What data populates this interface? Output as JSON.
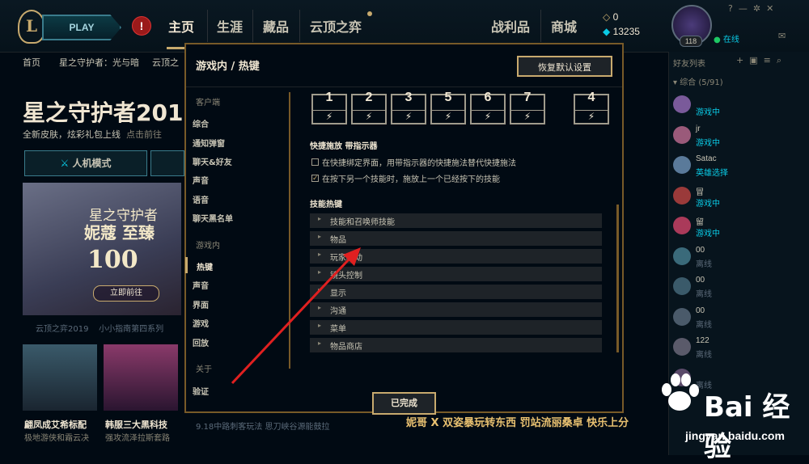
{
  "nav": {
    "logo": "L",
    "play": "PLAY",
    "alert": "!",
    "tabs": [
      "主页",
      "生涯",
      "藏品",
      "云顶之弈",
      "战利品",
      "商城"
    ],
    "currency1": "0",
    "currency2": "13235",
    "level": "118",
    "status": "在线"
  },
  "subnav": [
    "首页",
    "星之守护者：光与暗",
    "云顶之"
  ],
  "background": {
    "title": "星之守护者201",
    "subtitle": "全新皮肤，炫彩礼包上线",
    "subtitle_link": "点击前往",
    "mode_button": "人机模式",
    "banner_line1": "星之守护者",
    "banner_line2": "妮蔻 至臻",
    "banner_100": "100",
    "banner_btn": "立即前往",
    "caption1": "云顶之弈2019",
    "caption2": "小小指南第四系列",
    "thumbs": [
      {
        "title": "翩凤成艾希标配",
        "sub": "极地游侠和霜云决"
      },
      {
        "title": "韩服三大黑科技",
        "sub": "强攻流泽拉斯套路"
      }
    ],
    "bottom_text": "9.18中路刺客玩法 思刀峡谷源能鼓拉",
    "bottom_ad": "妮哥 X 双姿暴玩转东西 罚站流丽桑卓 快乐上分"
  },
  "social": {
    "title": "好友列表",
    "group": "▾ 综合 (5/91)",
    "friends": [
      {
        "name": "",
        "status": "游戏中"
      },
      {
        "name": "jr",
        "status": "游戏中"
      },
      {
        "name": "Satac",
        "status": "英雄选择"
      },
      {
        "name": "冒",
        "status": "游戏中"
      },
      {
        "name": "留",
        "status": "游戏中"
      },
      {
        "name": "00",
        "status": "离线"
      },
      {
        "name": "00",
        "status": "离线"
      },
      {
        "name": "00",
        "status": "离线"
      },
      {
        "name": "122",
        "status": "离线"
      },
      {
        "name": "",
        "status": "离线"
      }
    ]
  },
  "modal": {
    "title": "游戏内 / 热键",
    "reset_button": "恢复默认设置",
    "menu": {
      "client_header": "客户端",
      "client_items": [
        "综合",
        "通知弹窗",
        "聊天&好友",
        "声音",
        "语音",
        "聊天黑名单"
      ],
      "ingame_header": "游戏内",
      "ingame_items": [
        "热键",
        "声音",
        "界面",
        "游戏",
        "回放"
      ],
      "about_header": "关于",
      "about_items": [
        "验证"
      ]
    },
    "keys": [
      "1",
      "2",
      "3",
      "5",
      "6",
      "7",
      "4"
    ],
    "bolt": "⚡",
    "quickcast_title": "快捷施放 带指示器",
    "options": [
      {
        "label": "在快捷绑定界面，用带指示器的快捷施法替代快捷施法",
        "checked": false
      },
      {
        "label": "在按下另一个技能时，施放上一个已经按下的技能",
        "checked": true
      }
    ],
    "skills_title": "技能热键",
    "sections": [
      "技能和召唤师技能",
      "物品",
      "玩家移动",
      "镜头控制",
      "显示",
      "沟通",
      "菜单",
      "物品商店"
    ],
    "done_button": "已完成"
  },
  "watermark": {
    "brand": "Bai   经验",
    "url": "jingyan.baidu.com"
  }
}
